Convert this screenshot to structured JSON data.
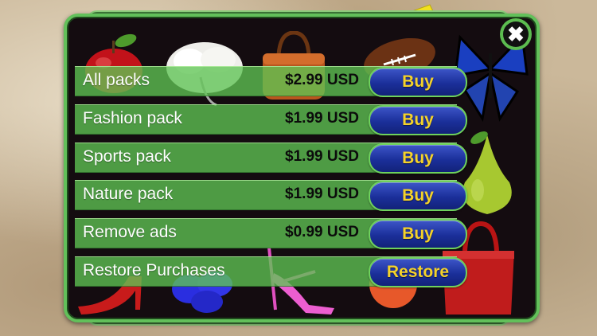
{
  "close": {
    "icon": "close-x-icon",
    "label": "✖"
  },
  "store": {
    "rows": [
      {
        "label": "All packs",
        "price": "$2.99 USD",
        "button": "Buy"
      },
      {
        "label": "Fashion pack",
        "price": "$1.99 USD",
        "button": "Buy"
      },
      {
        "label": "Sports pack",
        "price": "$1.99 USD",
        "button": "Buy"
      },
      {
        "label": "Nature pack",
        "price": "$1.99 USD",
        "button": "Buy"
      },
      {
        "label": "Remove ads",
        "price": "$0.99 USD",
        "button": "Buy"
      },
      {
        "label": "Restore Purchases",
        "price": "",
        "button": "Restore"
      }
    ]
  },
  "decor_items": [
    "apple-icon",
    "white-flower-icon",
    "handbag-icon",
    "football-icon",
    "butterfly-icon",
    "pear-icon",
    "red-high-heel-icon",
    "blue-flower-icon",
    "pink-sandal-icon",
    "peach-icon",
    "red-handbag-icon"
  ],
  "colors": {
    "button_text": "#f4d22a",
    "button_bg": "#1b2f9a",
    "row_bg": "#5fc453",
    "panel_bg": "#140c10",
    "border_green": "#62c05a"
  }
}
